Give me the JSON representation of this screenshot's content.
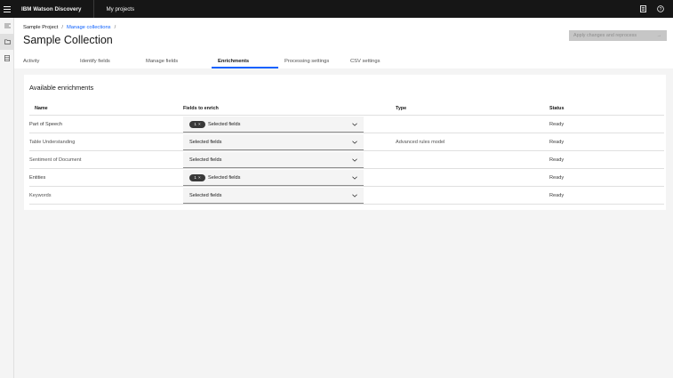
{
  "topbar": {
    "brand": "IBM Watson Discovery",
    "nav_link": "My projects"
  },
  "breadcrumb": {
    "project": "Sample Project",
    "sep1": "/",
    "collections": "Manage collections",
    "sep2": "/"
  },
  "page": {
    "title": "Sample Collection",
    "apply_button": "Apply changes and reprocess",
    "apply_arrow": "→"
  },
  "tabs": [
    {
      "label": "Activity",
      "active": false
    },
    {
      "label": "Identify fields",
      "active": false
    },
    {
      "label": "Manage fields",
      "active": false
    },
    {
      "label": "Enrichments",
      "active": true
    },
    {
      "label": "Processing settings",
      "active": false
    },
    {
      "label": "CSV settings",
      "active": false
    }
  ],
  "card": {
    "title": "Available enrichments"
  },
  "table": {
    "headers": {
      "name": "Name",
      "fields": "Fields to enrich",
      "type": "Type",
      "status": "Status"
    },
    "rows": [
      {
        "name": "Part of Speech",
        "tag_count": "1",
        "tag_close": "×",
        "fields": "Selected fields",
        "type": "",
        "status": "Ready"
      },
      {
        "name": "Table Understanding",
        "tag_count": "",
        "tag_close": "",
        "fields": "Selected fields",
        "type": "Advanced rules model",
        "status": "Ready"
      },
      {
        "name": "Sentiment of Document",
        "tag_count": "",
        "tag_close": "",
        "fields": "Selected fields",
        "type": "",
        "status": "Ready"
      },
      {
        "name": "Entities",
        "tag_count": "1",
        "tag_close": "×",
        "fields": "Selected fields",
        "type": "",
        "status": "Ready"
      },
      {
        "name": "Keywords",
        "tag_count": "",
        "tag_close": "",
        "fields": "Selected fields",
        "type": "",
        "status": "Ready"
      }
    ]
  },
  "icons": {
    "menu": "menu-icon",
    "topbar_right": [
      "document-icon",
      "help-icon"
    ],
    "rail": [
      "filter-icon",
      "folder-icon",
      "data-icon"
    ],
    "dropdown": "chevron-down-icon"
  },
  "colors": {
    "topbar": "#161616",
    "accent": "#0f62fe",
    "tag": "#393939",
    "disabled_button": "#c6c6c6"
  }
}
